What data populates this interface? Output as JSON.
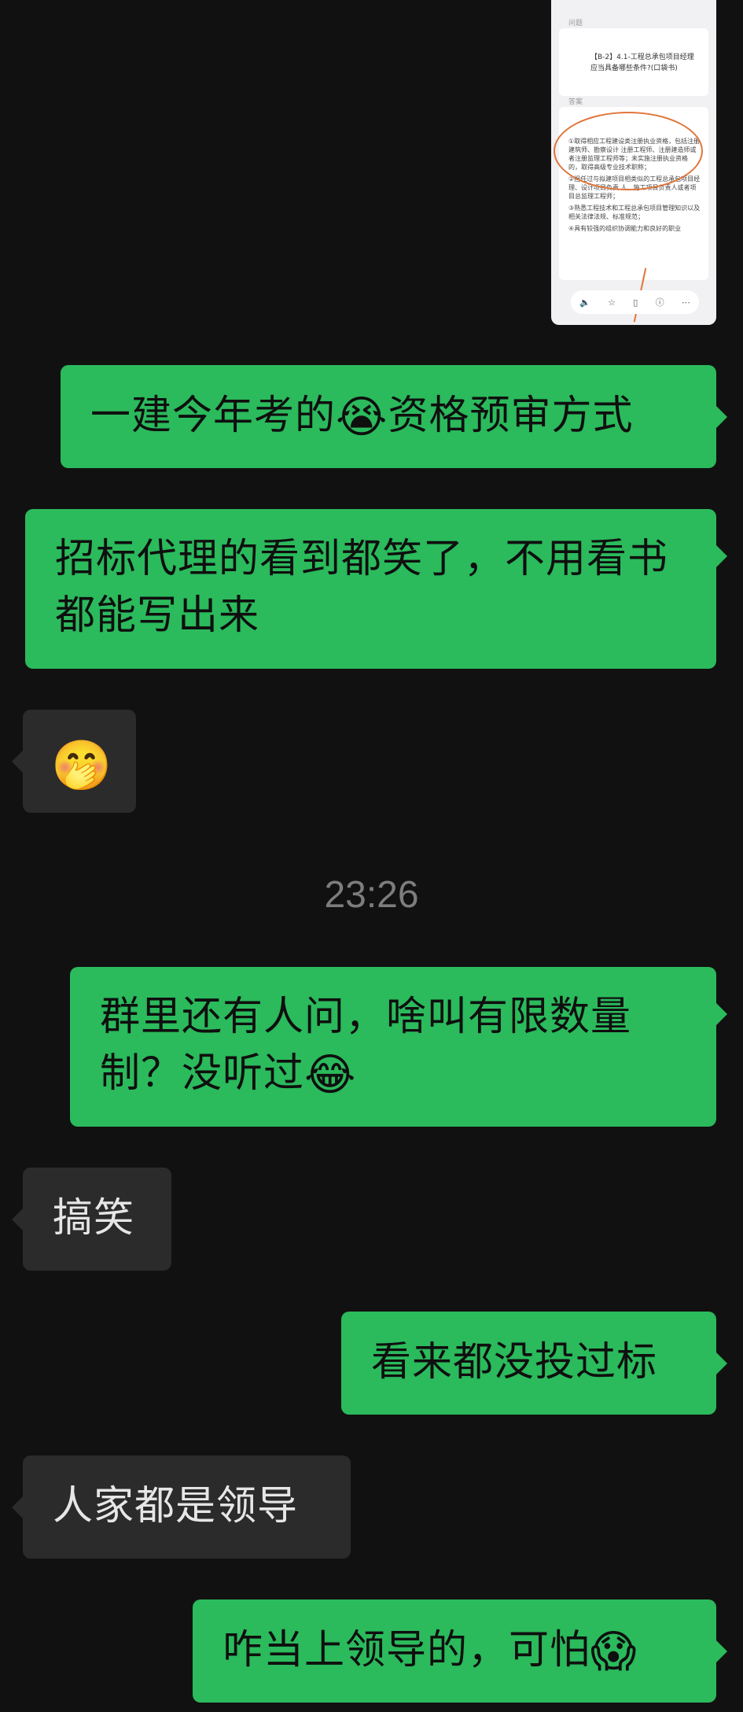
{
  "screenshot_card": {
    "question_label": "问题",
    "question_text": "【B-2】4.1-工程总承包项目经理应当具备哪些条件?(口袋书)",
    "answer_label": "答案",
    "answer_items": [
      "①取得相应工程建设类注册执业资格，包括注册建筑师、勘察设计 注册工程师、注册建造师或者注册监理工程师等；未实施注册执业资格 的，取得高级专业技术职称；",
      "②担任过与拟建项目相类似的工程总承包项目经理、设计项目负责 人、施工项目负责人或者项目总监理工程师；",
      "③熟悉工程技术和工程总承包项目管理知识以及相关法律法规、标准规范；",
      "④具有较强的组织协调能力和良好的职业"
    ],
    "toolbar_icons": [
      "speaker-icon",
      "star-icon",
      "copy-icon",
      "info-icon",
      "more-icon"
    ]
  },
  "messages": [
    {
      "id": "m1",
      "direction": "out",
      "text": "一建今年考的",
      "emoji": "😭",
      "text_after": "资格预审方式"
    },
    {
      "id": "m2",
      "direction": "out",
      "text": "招标代理的看到都笑了，不用看书都能写出来"
    },
    {
      "id": "m3",
      "direction": "in",
      "emoji": "🤭"
    },
    {
      "id": "m4",
      "direction": "out",
      "text": "群里还有人问，啥叫有限数量制？没听过",
      "emoji": "😂"
    },
    {
      "id": "m5",
      "direction": "in",
      "text": "搞笑"
    },
    {
      "id": "m6",
      "direction": "out",
      "text": "看来都没投过标"
    },
    {
      "id": "m7",
      "direction": "in",
      "text": "人家都是领导"
    },
    {
      "id": "m8",
      "direction": "out",
      "text": "咋当上领导的，可怕",
      "emoji": "😱"
    }
  ],
  "timestamp": "23:26",
  "colors": {
    "background": "#111111",
    "outgoing_bubble": "#2bba5c",
    "incoming_bubble": "#2b2b2b",
    "timestamp_text": "#7d7d7d",
    "annotation": "#e0753a"
  }
}
